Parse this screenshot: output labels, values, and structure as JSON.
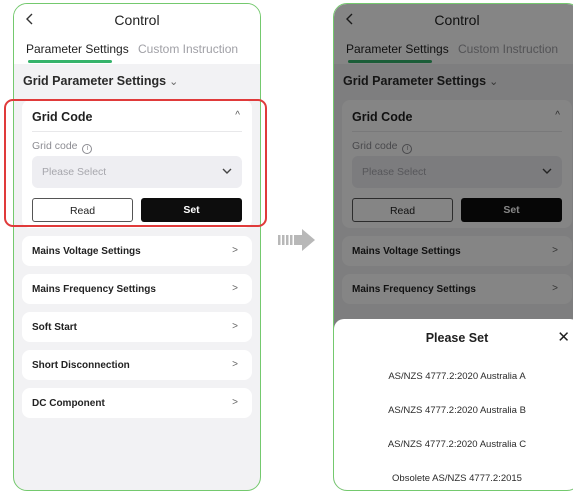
{
  "left_screen": {
    "header": {
      "title": "Control"
    },
    "tabs": [
      {
        "label": "Parameter Settings",
        "active": true
      },
      {
        "label": "Custom Instruction",
        "active": false
      }
    ],
    "section": {
      "title": "Grid Parameter Settings",
      "chevron": "⌄"
    },
    "grid_code_card": {
      "title": "Grid Code",
      "collapse_icon": "^",
      "field_label": "Grid code",
      "info_icon": "i",
      "select_placeholder": "Please Select",
      "read_label": "Read",
      "set_label": "Set"
    },
    "rows": [
      {
        "label": "Mains Voltage Settings",
        "chevron": ">"
      },
      {
        "label": "Mains Frequency Settings",
        "chevron": ">"
      },
      {
        "label": "Soft Start",
        "chevron": ">"
      },
      {
        "label": "Short Disconnection",
        "chevron": ">"
      },
      {
        "label": "DC Component",
        "chevron": ">"
      }
    ]
  },
  "right_screen": {
    "header": {
      "title": "Control"
    },
    "tabs": [
      {
        "label": "Parameter Settings",
        "active": true
      },
      {
        "label": "Custom Instruction",
        "active": false
      }
    ],
    "section": {
      "title": "Grid Parameter Settings",
      "chevron": "⌄"
    },
    "grid_code_card": {
      "title": "Grid Code",
      "collapse_icon": "^",
      "field_label": "Grid code",
      "info_icon": "i",
      "select_placeholder": "Please Select",
      "read_label": "Read",
      "set_label": "Set"
    },
    "rows": [
      {
        "label": "Mains Voltage Settings",
        "chevron": ">"
      },
      {
        "label": "Mains Frequency Settings",
        "chevron": ">"
      }
    ],
    "sheet": {
      "title": "Please Set",
      "close_icon": "✕",
      "options": [
        "AS/NZS 4777.2:2020  Australia A",
        "AS/NZS 4777.2:2020  Australia B",
        "AS/NZS 4777.2:2020  Australia C",
        "Obsolete AS/NZS 4777.2:2015"
      ]
    }
  },
  "colors": {
    "phone_border": "#74c96e",
    "tab_underline": "#35b36b",
    "highlight_border": "#e03a3a",
    "set_button": "#0d0d0d",
    "background": "#f2f2f4"
  },
  "icons": {
    "back": "chevron-left-icon",
    "transition": "arrow-right-icon"
  }
}
